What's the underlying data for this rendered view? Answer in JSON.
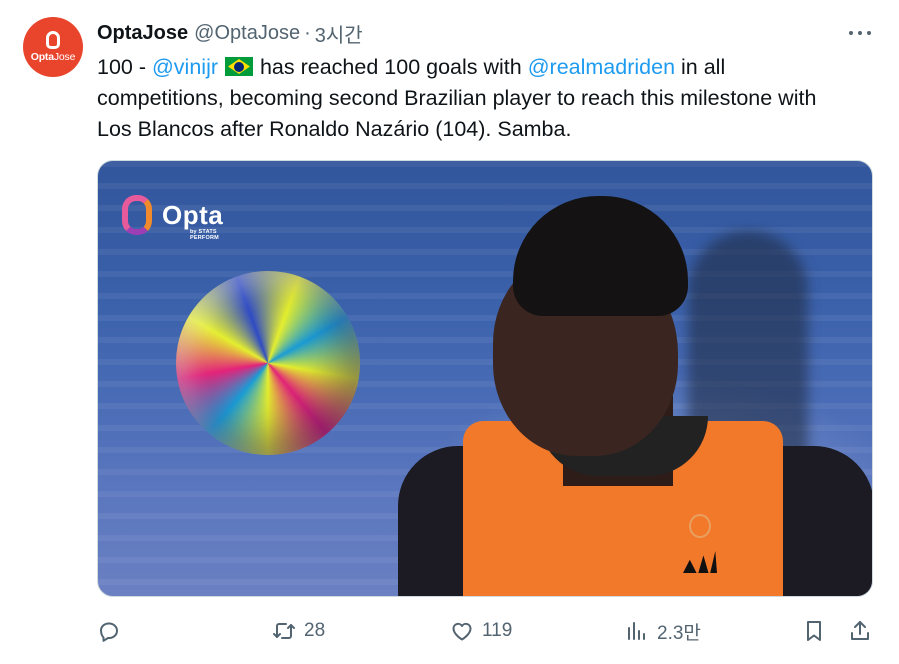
{
  "tweet": {
    "author_name": "OptaJose",
    "author_handle": "@OptaJose",
    "separator": "·",
    "time": "3시간",
    "avatar_text_bold": "Opta",
    "avatar_text_light": "Jose",
    "text": {
      "prefix": "100 - ",
      "mention_1": "@vinijr",
      "middle": " has reached 100 goals with ",
      "mention_2": "@realmadriden",
      "suffix": " in all competitions, becoming second Brazilian player to reach this milestone with Los Blancos after Ronaldo Nazário (104). Samba."
    },
    "flag_icon": "brazil-flag",
    "media": {
      "watermark": "Opta",
      "watermark_sub": "by STATS PERFORM"
    },
    "actions": {
      "reply_count": "",
      "retweet_count": "28",
      "like_count": "119",
      "views_count": "2.3만"
    }
  },
  "colors": {
    "link": "#1d9bf0",
    "secondary_text": "#536471",
    "avatar_bg": "#e8452c"
  }
}
